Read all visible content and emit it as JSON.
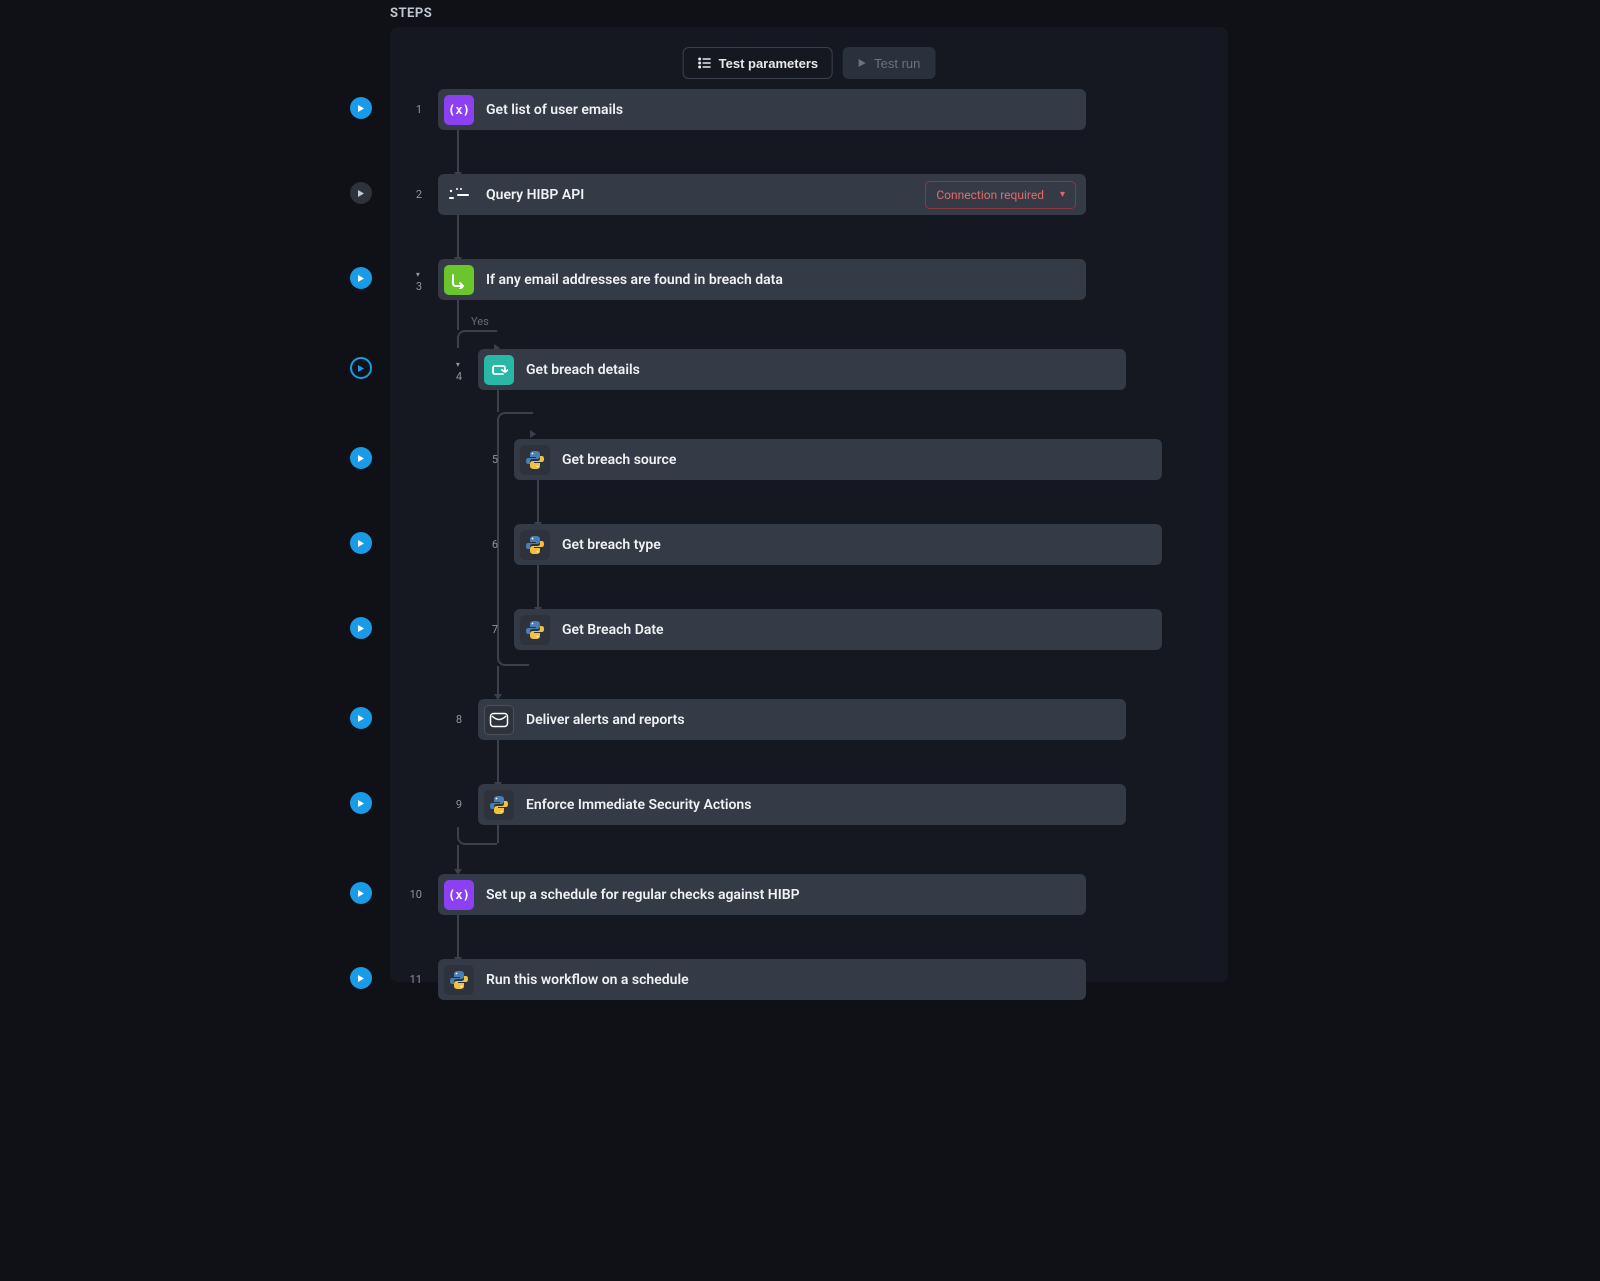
{
  "header": {
    "steps_label": "STEPS",
    "test_parameters": "Test parameters",
    "test_run": "Test run"
  },
  "badges": {
    "connection_required": "Connection required"
  },
  "branch_labels": {
    "yes": "Yes"
  },
  "steps": [
    {
      "num": "1",
      "label": "Get list of user emails"
    },
    {
      "num": "2",
      "label": "Query HIBP API"
    },
    {
      "num": "3",
      "label": "If any email addresses are found in breach data"
    },
    {
      "num": "4",
      "label": "Get breach details"
    },
    {
      "num": "5",
      "label": "Get breach source"
    },
    {
      "num": "6",
      "label": "Get breach type"
    },
    {
      "num": "7",
      "label": "Get Breach Date"
    },
    {
      "num": "8",
      "label": "Deliver alerts and reports"
    },
    {
      "num": "9",
      "label": "Enforce Immediate Security Actions"
    },
    {
      "num": "10",
      "label": "Set up a schedule for regular checks against HIBP"
    },
    {
      "num": "11",
      "label": "Run this workflow on a schedule"
    }
  ]
}
